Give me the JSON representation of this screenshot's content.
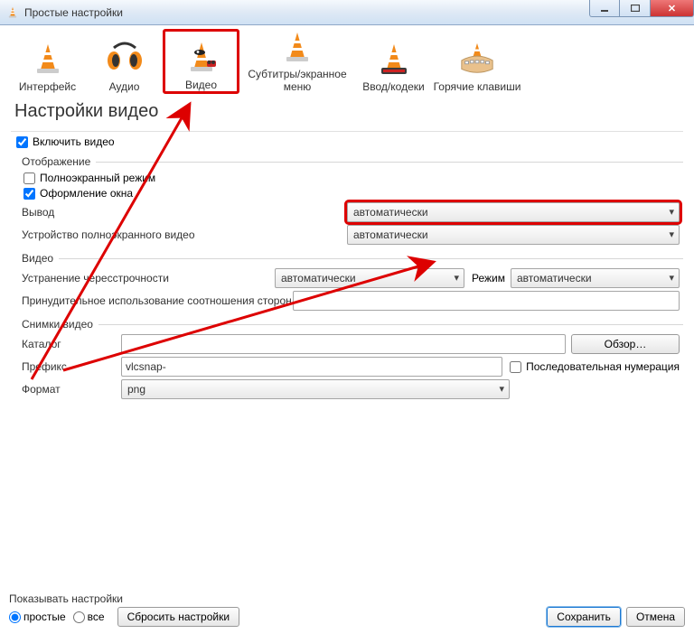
{
  "window": {
    "title": "Простые настройки"
  },
  "tabs": [
    {
      "label": "Интерфейс"
    },
    {
      "label": "Аудио"
    },
    {
      "label": "Видео",
      "selected": true
    },
    {
      "label": "Субтитры/экранное меню"
    },
    {
      "label": "Ввод/кодеки"
    },
    {
      "label": "Горячие клавиши"
    }
  ],
  "page_title": "Настройки видео",
  "enable_video": {
    "label": "Включить видео",
    "checked": true
  },
  "groups": {
    "display": {
      "title": "Отображение",
      "fullscreen": {
        "label": "Полноэкранный режим",
        "checked": false
      },
      "decorations": {
        "label": "Оформление окна",
        "checked": true
      },
      "output": {
        "label": "Вывод",
        "value": "автоматически"
      },
      "fsdevice": {
        "label": "Устройство полноэкранного видео",
        "value": "автоматически"
      }
    },
    "video": {
      "title": "Видео",
      "deinterlace": {
        "label": "Устранение чересстрочности",
        "value": "автоматически"
      },
      "mode": {
        "label": "Режим",
        "value": "автоматически"
      },
      "force_ar": {
        "label": "Принудительное использование соотношения сторон",
        "value": ""
      }
    },
    "snapshots": {
      "title": "Снимки видео",
      "folder": {
        "label": "Каталог",
        "value": "",
        "browse": "Обзор…"
      },
      "prefix": {
        "label": "Префикс",
        "value": "vlcsnap-",
        "seq": "Последовательная нумерация"
      },
      "format": {
        "label": "Формат",
        "value": "png"
      }
    }
  },
  "footer": {
    "showlabel": "Показывать настройки",
    "simple": "простые",
    "all": "все",
    "reset": "Сбросить настройки",
    "save": "Сохранить",
    "cancel": "Отмена"
  }
}
